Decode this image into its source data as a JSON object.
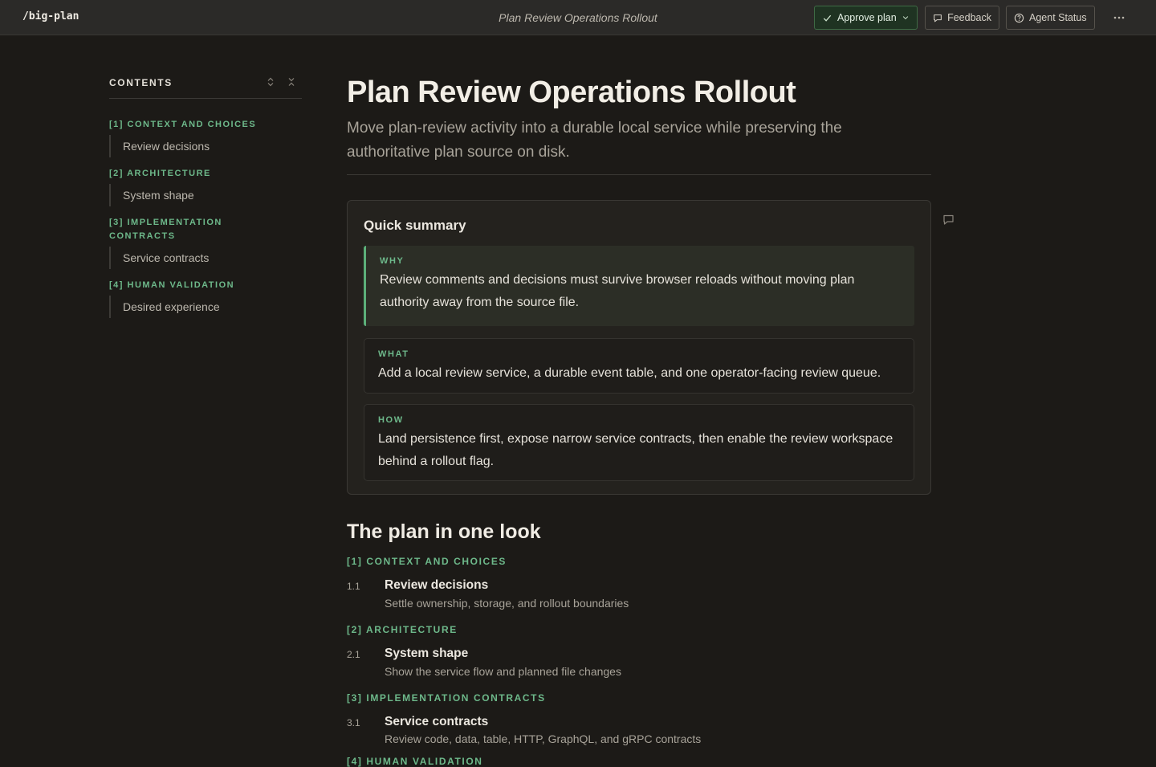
{
  "app": {
    "brand": "/big-plan",
    "doc_title": "Plan Review Operations Rollout"
  },
  "toolbar": {
    "approve_label": "Approve plan",
    "feedback_label": "Feedback",
    "agent_status_label": "Agent Status"
  },
  "toc": {
    "heading": "CONTENTS",
    "sections": [
      {
        "label": "[1] CONTEXT AND CHOICES",
        "items": [
          "Review decisions"
        ]
      },
      {
        "label": "[2] ARCHITECTURE",
        "items": [
          "System shape"
        ]
      },
      {
        "label": "[3] IMPLEMENTATION CONTRACTS",
        "items": [
          "Service contracts"
        ]
      },
      {
        "label": "[4] HUMAN VALIDATION",
        "items": [
          "Desired experience"
        ]
      }
    ]
  },
  "main": {
    "title": "Plan Review Operations Rollout",
    "lede": "Move plan-review activity into a durable local service while preserving the authoritative plan source on disk.",
    "summary": {
      "title": "Quick summary",
      "why": {
        "label": "WHY",
        "body": "Review comments and decisions must survive browser reloads without moving plan authority away from the source file."
      },
      "what": {
        "label": "WHAT",
        "body": "Add a local review service, a durable event table, and one operator-facing review queue."
      },
      "how": {
        "label": "HOW",
        "body": "Land persistence first, expose narrow service contracts, then enable the review workspace behind a rollout flag."
      }
    },
    "overview": {
      "title": "The plan in one look",
      "sections": [
        {
          "label": "[1] CONTEXT AND CHOICES",
          "items": [
            {
              "num": "1.1",
              "title": "Review decisions",
              "desc": "Settle ownership, storage, and rollout boundaries"
            }
          ]
        },
        {
          "label": "[2] ARCHITECTURE",
          "items": [
            {
              "num": "2.1",
              "title": "System shape",
              "desc": "Show the service flow and planned file changes"
            }
          ]
        },
        {
          "label": "[3] IMPLEMENTATION CONTRACTS",
          "items": [
            {
              "num": "3.1",
              "title": "Service contracts",
              "desc": "Review code, data, table, HTTP, GraphQL, and gRPC contracts"
            }
          ]
        },
        {
          "label": "[4] HUMAN VALIDATION",
          "items": []
        }
      ]
    }
  },
  "colors": {
    "accent": "#6db88a",
    "background": "#1c1a17",
    "approve_bg": "#1f3322"
  }
}
